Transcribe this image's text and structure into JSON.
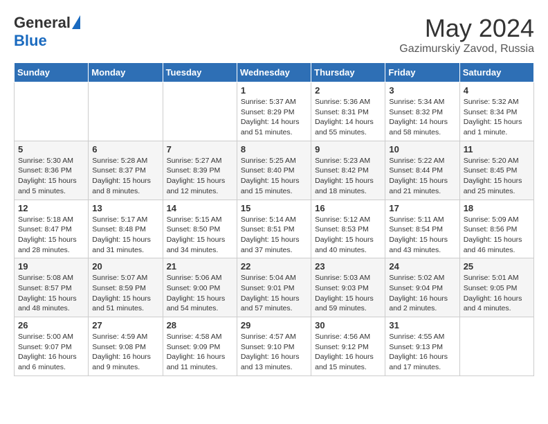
{
  "header": {
    "logo_general": "General",
    "logo_blue": "Blue",
    "month_year": "May 2024",
    "location": "Gazimurskiy Zavod, Russia"
  },
  "days_of_week": [
    "Sunday",
    "Monday",
    "Tuesday",
    "Wednesday",
    "Thursday",
    "Friday",
    "Saturday"
  ],
  "weeks": [
    [
      {
        "day": "",
        "content": ""
      },
      {
        "day": "",
        "content": ""
      },
      {
        "day": "",
        "content": ""
      },
      {
        "day": "1",
        "content": "Sunrise: 5:37 AM\nSunset: 8:29 PM\nDaylight: 14 hours\nand 51 minutes."
      },
      {
        "day": "2",
        "content": "Sunrise: 5:36 AM\nSunset: 8:31 PM\nDaylight: 14 hours\nand 55 minutes."
      },
      {
        "day": "3",
        "content": "Sunrise: 5:34 AM\nSunset: 8:32 PM\nDaylight: 14 hours\nand 58 minutes."
      },
      {
        "day": "4",
        "content": "Sunrise: 5:32 AM\nSunset: 8:34 PM\nDaylight: 15 hours\nand 1 minute."
      }
    ],
    [
      {
        "day": "5",
        "content": "Sunrise: 5:30 AM\nSunset: 8:36 PM\nDaylight: 15 hours\nand 5 minutes."
      },
      {
        "day": "6",
        "content": "Sunrise: 5:28 AM\nSunset: 8:37 PM\nDaylight: 15 hours\nand 8 minutes."
      },
      {
        "day": "7",
        "content": "Sunrise: 5:27 AM\nSunset: 8:39 PM\nDaylight: 15 hours\nand 12 minutes."
      },
      {
        "day": "8",
        "content": "Sunrise: 5:25 AM\nSunset: 8:40 PM\nDaylight: 15 hours\nand 15 minutes."
      },
      {
        "day": "9",
        "content": "Sunrise: 5:23 AM\nSunset: 8:42 PM\nDaylight: 15 hours\nand 18 minutes."
      },
      {
        "day": "10",
        "content": "Sunrise: 5:22 AM\nSunset: 8:44 PM\nDaylight: 15 hours\nand 21 minutes."
      },
      {
        "day": "11",
        "content": "Sunrise: 5:20 AM\nSunset: 8:45 PM\nDaylight: 15 hours\nand 25 minutes."
      }
    ],
    [
      {
        "day": "12",
        "content": "Sunrise: 5:18 AM\nSunset: 8:47 PM\nDaylight: 15 hours\nand 28 minutes."
      },
      {
        "day": "13",
        "content": "Sunrise: 5:17 AM\nSunset: 8:48 PM\nDaylight: 15 hours\nand 31 minutes."
      },
      {
        "day": "14",
        "content": "Sunrise: 5:15 AM\nSunset: 8:50 PM\nDaylight: 15 hours\nand 34 minutes."
      },
      {
        "day": "15",
        "content": "Sunrise: 5:14 AM\nSunset: 8:51 PM\nDaylight: 15 hours\nand 37 minutes."
      },
      {
        "day": "16",
        "content": "Sunrise: 5:12 AM\nSunset: 8:53 PM\nDaylight: 15 hours\nand 40 minutes."
      },
      {
        "day": "17",
        "content": "Sunrise: 5:11 AM\nSunset: 8:54 PM\nDaylight: 15 hours\nand 43 minutes."
      },
      {
        "day": "18",
        "content": "Sunrise: 5:09 AM\nSunset: 8:56 PM\nDaylight: 15 hours\nand 46 minutes."
      }
    ],
    [
      {
        "day": "19",
        "content": "Sunrise: 5:08 AM\nSunset: 8:57 PM\nDaylight: 15 hours\nand 48 minutes."
      },
      {
        "day": "20",
        "content": "Sunrise: 5:07 AM\nSunset: 8:59 PM\nDaylight: 15 hours\nand 51 minutes."
      },
      {
        "day": "21",
        "content": "Sunrise: 5:06 AM\nSunset: 9:00 PM\nDaylight: 15 hours\nand 54 minutes."
      },
      {
        "day": "22",
        "content": "Sunrise: 5:04 AM\nSunset: 9:01 PM\nDaylight: 15 hours\nand 57 minutes."
      },
      {
        "day": "23",
        "content": "Sunrise: 5:03 AM\nSunset: 9:03 PM\nDaylight: 15 hours\nand 59 minutes."
      },
      {
        "day": "24",
        "content": "Sunrise: 5:02 AM\nSunset: 9:04 PM\nDaylight: 16 hours\nand 2 minutes."
      },
      {
        "day": "25",
        "content": "Sunrise: 5:01 AM\nSunset: 9:05 PM\nDaylight: 16 hours\nand 4 minutes."
      }
    ],
    [
      {
        "day": "26",
        "content": "Sunrise: 5:00 AM\nSunset: 9:07 PM\nDaylight: 16 hours\nand 6 minutes."
      },
      {
        "day": "27",
        "content": "Sunrise: 4:59 AM\nSunset: 9:08 PM\nDaylight: 16 hours\nand 9 minutes."
      },
      {
        "day": "28",
        "content": "Sunrise: 4:58 AM\nSunset: 9:09 PM\nDaylight: 16 hours\nand 11 minutes."
      },
      {
        "day": "29",
        "content": "Sunrise: 4:57 AM\nSunset: 9:10 PM\nDaylight: 16 hours\nand 13 minutes."
      },
      {
        "day": "30",
        "content": "Sunrise: 4:56 AM\nSunset: 9:12 PM\nDaylight: 16 hours\nand 15 minutes."
      },
      {
        "day": "31",
        "content": "Sunrise: 4:55 AM\nSunset: 9:13 PM\nDaylight: 16 hours\nand 17 minutes."
      },
      {
        "day": "",
        "content": ""
      }
    ]
  ]
}
